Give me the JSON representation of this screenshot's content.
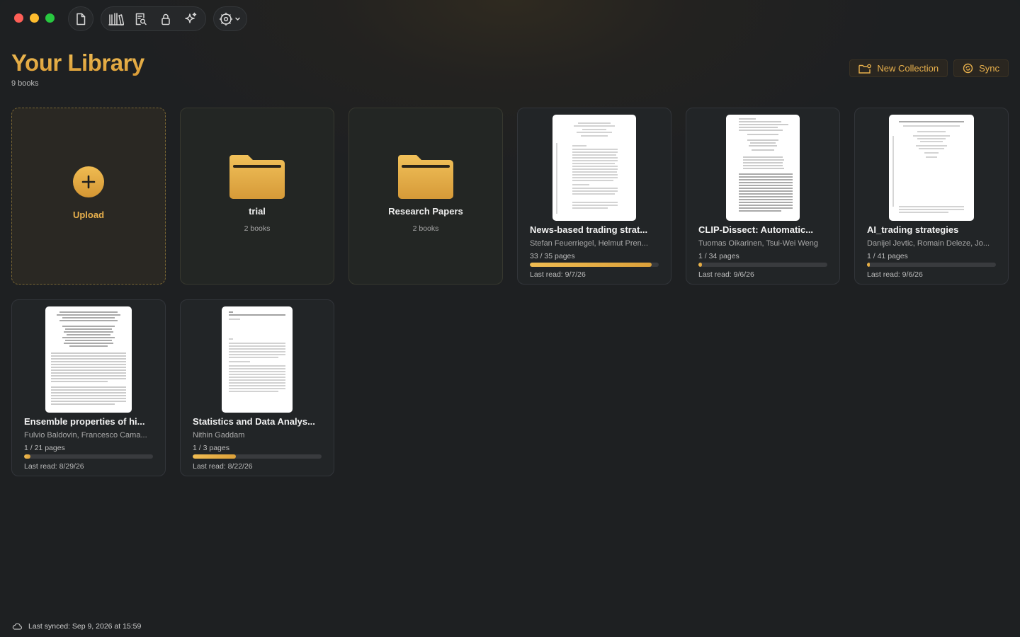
{
  "toolbar": {
    "document_icon": "document-icon",
    "library_icon": "library-icon",
    "reader_icon": "reader-search-icon",
    "lock_icon": "lock-icon",
    "sparkle_icon": "sparkle-icon",
    "settings_icon": "gear-dropdown-icon"
  },
  "header": {
    "title": "Your Library",
    "count": "9 books",
    "new_collection_label": "New Collection",
    "sync_label": "Sync"
  },
  "colors": {
    "accent": "#e8b04c",
    "background": "#1d2022",
    "card": "#222527"
  },
  "upload": {
    "label": "Upload"
  },
  "folders": [
    {
      "name": "trial",
      "count": "2 books"
    },
    {
      "name": "Research Papers",
      "count": "2 books"
    }
  ],
  "books": [
    {
      "title": "News-based trading strat...",
      "authors": "Stefan Feuerriegel, Helmut Pren...",
      "pages": "33 / 35 pages",
      "progress": 0.943,
      "last_read": "Last read: 9/7/26"
    },
    {
      "title": "CLIP-Dissect: Automatic...",
      "authors": "Tuomas Oikarinen, Tsui-Wei Weng",
      "pages": "1 / 34 pages",
      "progress": 0.029,
      "last_read": "Last read: 9/6/26"
    },
    {
      "title": "AI_trading strategies",
      "authors": "Danijel Jevtic, Romain Deleze, Jo...",
      "pages": "1 / 41 pages",
      "progress": 0.024,
      "last_read": "Last read: 9/6/26"
    },
    {
      "title": "Ensemble properties of hi...",
      "authors": "Fulvio Baldovin, Francesco Cama...",
      "pages": "1 / 21 pages",
      "progress": 0.048,
      "last_read": "Last read: 8/29/26"
    },
    {
      "title": "Statistics and Data Analys...",
      "authors": "Nithin Gaddam",
      "pages": "1 / 3 pages",
      "progress": 0.333,
      "last_read": "Last read: 8/22/26"
    }
  ],
  "footer": {
    "status": "Last synced: Sep 9, 2026 at 15:59",
    "icon": "cloud-icon"
  }
}
